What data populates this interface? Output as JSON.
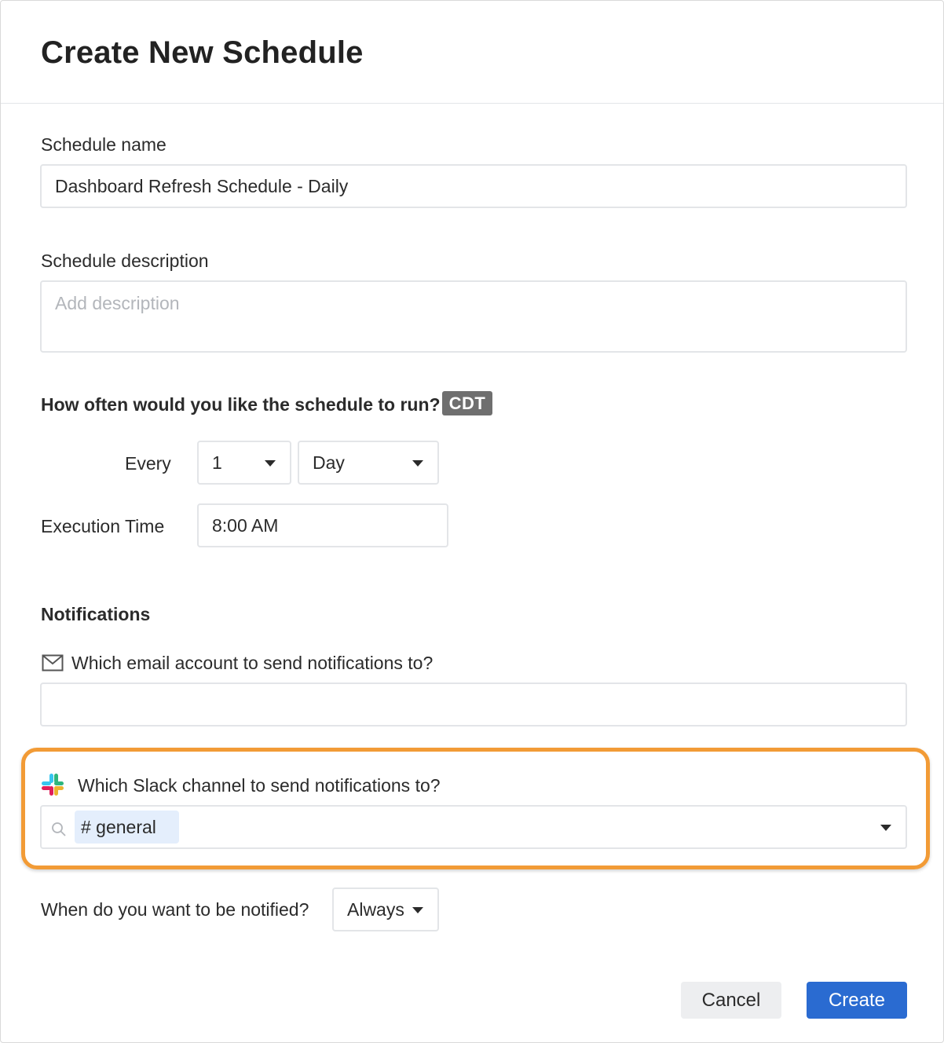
{
  "dialog": {
    "title": "Create New Schedule"
  },
  "schedule_name": {
    "label": "Schedule name",
    "value": "Dashboard Refresh Schedule - Daily"
  },
  "schedule_description": {
    "label": "Schedule description",
    "placeholder": "Add description"
  },
  "frequency": {
    "question": "How often would you like the schedule to run?",
    "timezone_badge": "CDT",
    "every_label": "Every",
    "interval_value": "1",
    "unit_value": "Day",
    "execution_time_label": "Execution Time",
    "execution_time_value": "8:00 AM"
  },
  "notifications": {
    "title": "Notifications",
    "email_question": "Which email account to send notifications to?",
    "email_value": "",
    "email_icon": "envelope-icon",
    "slack_question": "Which Slack channel to send notifications to?",
    "slack_icon": "slack-icon",
    "slack_channel": "# general",
    "when_question": "When do you want to be notified?",
    "when_value": "Always"
  },
  "footer": {
    "cancel_label": "Cancel",
    "create_label": "Create"
  },
  "colors": {
    "primary": "#2a6bd1",
    "highlight": "#f29b36",
    "badge_bg": "#6f6f6f",
    "chip_bg": "#e4eefc"
  }
}
